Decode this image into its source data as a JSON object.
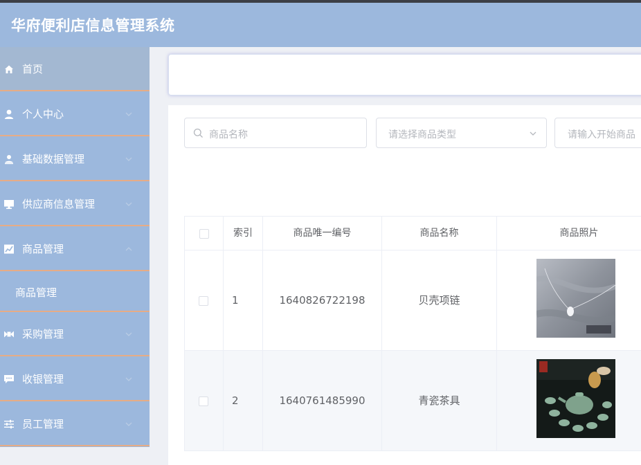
{
  "header": {
    "title": "华府便利店信息管理系统"
  },
  "sidebar": {
    "items": [
      {
        "label": "首页",
        "icon": "home-icon",
        "active": true
      },
      {
        "label": "个人中心",
        "icon": "user-icon"
      },
      {
        "label": "基础数据管理",
        "icon": "user-data-icon"
      },
      {
        "label": "供应商信息管理",
        "icon": "monitor-icon"
      },
      {
        "label": "商品管理",
        "icon": "chart-icon"
      },
      {
        "label": "商品管理",
        "submenu": true
      },
      {
        "label": "采购管理",
        "icon": "ticket-icon"
      },
      {
        "label": "收银管理",
        "icon": "chat-icon"
      },
      {
        "label": "员工管理",
        "icon": "sliders-icon"
      }
    ]
  },
  "filters": {
    "name_placeholder": "商品名称",
    "type_placeholder": "请选择商品类型",
    "start_placeholder": "请输入开始商品"
  },
  "table": {
    "headers": [
      "索引",
      "商品唯一编号",
      "商品名称",
      "商品照片"
    ],
    "rows": [
      {
        "index": "1",
        "code": "1640826722198",
        "name": "贝壳项链",
        "photo": "necklace-photo"
      },
      {
        "index": "2",
        "code": "1640761485990",
        "name": "青瓷茶具",
        "photo": "tea-set-photo"
      }
    ]
  },
  "colors": {
    "sidebar": "#9cb8dd",
    "sidebar_active": "#a3b8d2",
    "divider": "#e7ac86",
    "content_bg": "#eef0f5",
    "row_alt": "#f5f7fa"
  }
}
